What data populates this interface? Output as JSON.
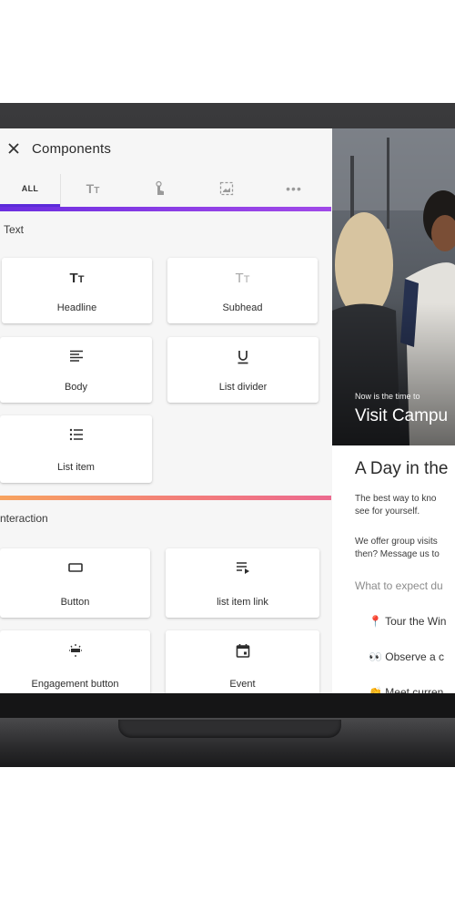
{
  "panel": {
    "title": "Components",
    "close_icon": "close-icon",
    "tabs": [
      {
        "label": "ALL",
        "icon": ""
      },
      {
        "label": "",
        "icon": "text-format-icon"
      },
      {
        "label": "",
        "icon": "touch-icon"
      },
      {
        "label": "",
        "icon": "image-icon"
      },
      {
        "label": "",
        "icon": "more-horiz-icon"
      }
    ],
    "sections": [
      {
        "label": "Text",
        "cards": [
          {
            "label": "Headline",
            "icon": "text-fields-icon"
          },
          {
            "label": "Subhead",
            "icon": "text-fields-light-icon"
          },
          {
            "label": "Body",
            "icon": "align-left-icon"
          },
          {
            "label": "List divider",
            "icon": "underline-icon"
          },
          {
            "label": "List item",
            "icon": "list-bullets-icon"
          }
        ]
      },
      {
        "label": "nteraction",
        "cards": [
          {
            "label": "Button",
            "icon": "button-outline-icon"
          },
          {
            "label": "list item link",
            "icon": "playlist-play-icon"
          },
          {
            "label": "Engagement button",
            "icon": "engagement-icon"
          },
          {
            "label": "Event",
            "icon": "calendar-icon"
          }
        ]
      }
    ],
    "accent_purple": "#5b2bd9",
    "accent_orange": "#f27b7c"
  },
  "preview": {
    "hero_small": "Now is the time to",
    "hero_large": "Visit Campu",
    "heading": "A Day in the",
    "body1_line1": "The best way to kno",
    "body1_line2": "see for yourself.",
    "body2_line1": "We offer group visits",
    "body2_line2": "then? Message us to",
    "subheading": "What to expect du",
    "items": [
      {
        "emoji": "📍",
        "text": "Tour the Win"
      },
      {
        "emoji": "👀",
        "text": "Observe a c"
      },
      {
        "emoji": "👏",
        "text": "Meet curren"
      }
    ]
  }
}
